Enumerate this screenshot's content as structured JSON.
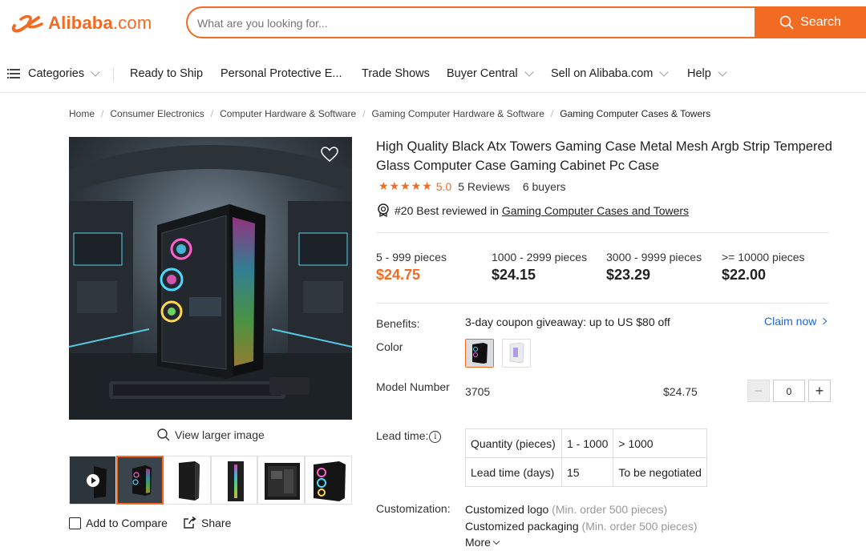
{
  "brand": {
    "logo_text": "Alibaba",
    "logo_suffix": ".com",
    "color": "#f26b22"
  },
  "search": {
    "placeholder": "What are you looking for...",
    "button_label": "Search"
  },
  "nav": {
    "categories": "Categories",
    "ready_to_ship": "Ready to Ship",
    "ppe": "Personal Protective E...",
    "trade_shows": "Trade Shows",
    "buyer_central": "Buyer Central",
    "sell": "Sell on Alibaba.com",
    "help": "Help"
  },
  "breadcrumb": [
    "Home",
    "Consumer Electronics",
    "Computer Hardware & Software",
    "Gaming Computer Hardware & Software",
    "Gaming Computer Cases & Towers"
  ],
  "gallery": {
    "view_larger": "View larger image",
    "add_to_compare": "Add to Compare",
    "share": "Share"
  },
  "product": {
    "title": "High Quality Black Atx Towers Gaming Case Metal Mesh Argb Strip Tempered Glass Computer Case Gaming Cabinet Pc Case",
    "stars": "★★★★★",
    "score": "5.0",
    "reviews": "5 Reviews",
    "buyers": "6 buyers",
    "best_prefix": "#20 Best reviewed in ",
    "best_link": "Gaming Computer Cases and Towers"
  },
  "prices": [
    {
      "range": "5 - 999 pieces",
      "price": "$24.75"
    },
    {
      "range": "1000 - 2999 pieces",
      "price": "$24.15"
    },
    {
      "range": "3000 - 9999 pieces",
      "price": "$23.29"
    },
    {
      "range": ">= 10000 pieces",
      "price": "$22.00"
    }
  ],
  "benefits": {
    "label": "Benefits:",
    "text": "3-day coupon giveaway: up to US $80 off",
    "claim": "Claim now"
  },
  "color": {
    "label": "Color"
  },
  "model": {
    "label": "Model Number",
    "value": "3705",
    "price": "$24.75",
    "quantity": "0",
    "minus": "−",
    "plus": "+"
  },
  "lead_time": {
    "label": "Lead time:",
    "info": "i",
    "rows": [
      [
        "Quantity (pieces)",
        "1 - 1000",
        "> 1000"
      ],
      [
        "Lead time (days)",
        "15",
        "To be negotiated"
      ]
    ]
  },
  "customization": {
    "label": "Customization:",
    "items": [
      {
        "name": "Customized logo",
        "note": " (Min. order 500 pieces)"
      },
      {
        "name": "Customized packaging",
        "note": " (Min. order 500 pieces)"
      }
    ],
    "more": "More"
  }
}
